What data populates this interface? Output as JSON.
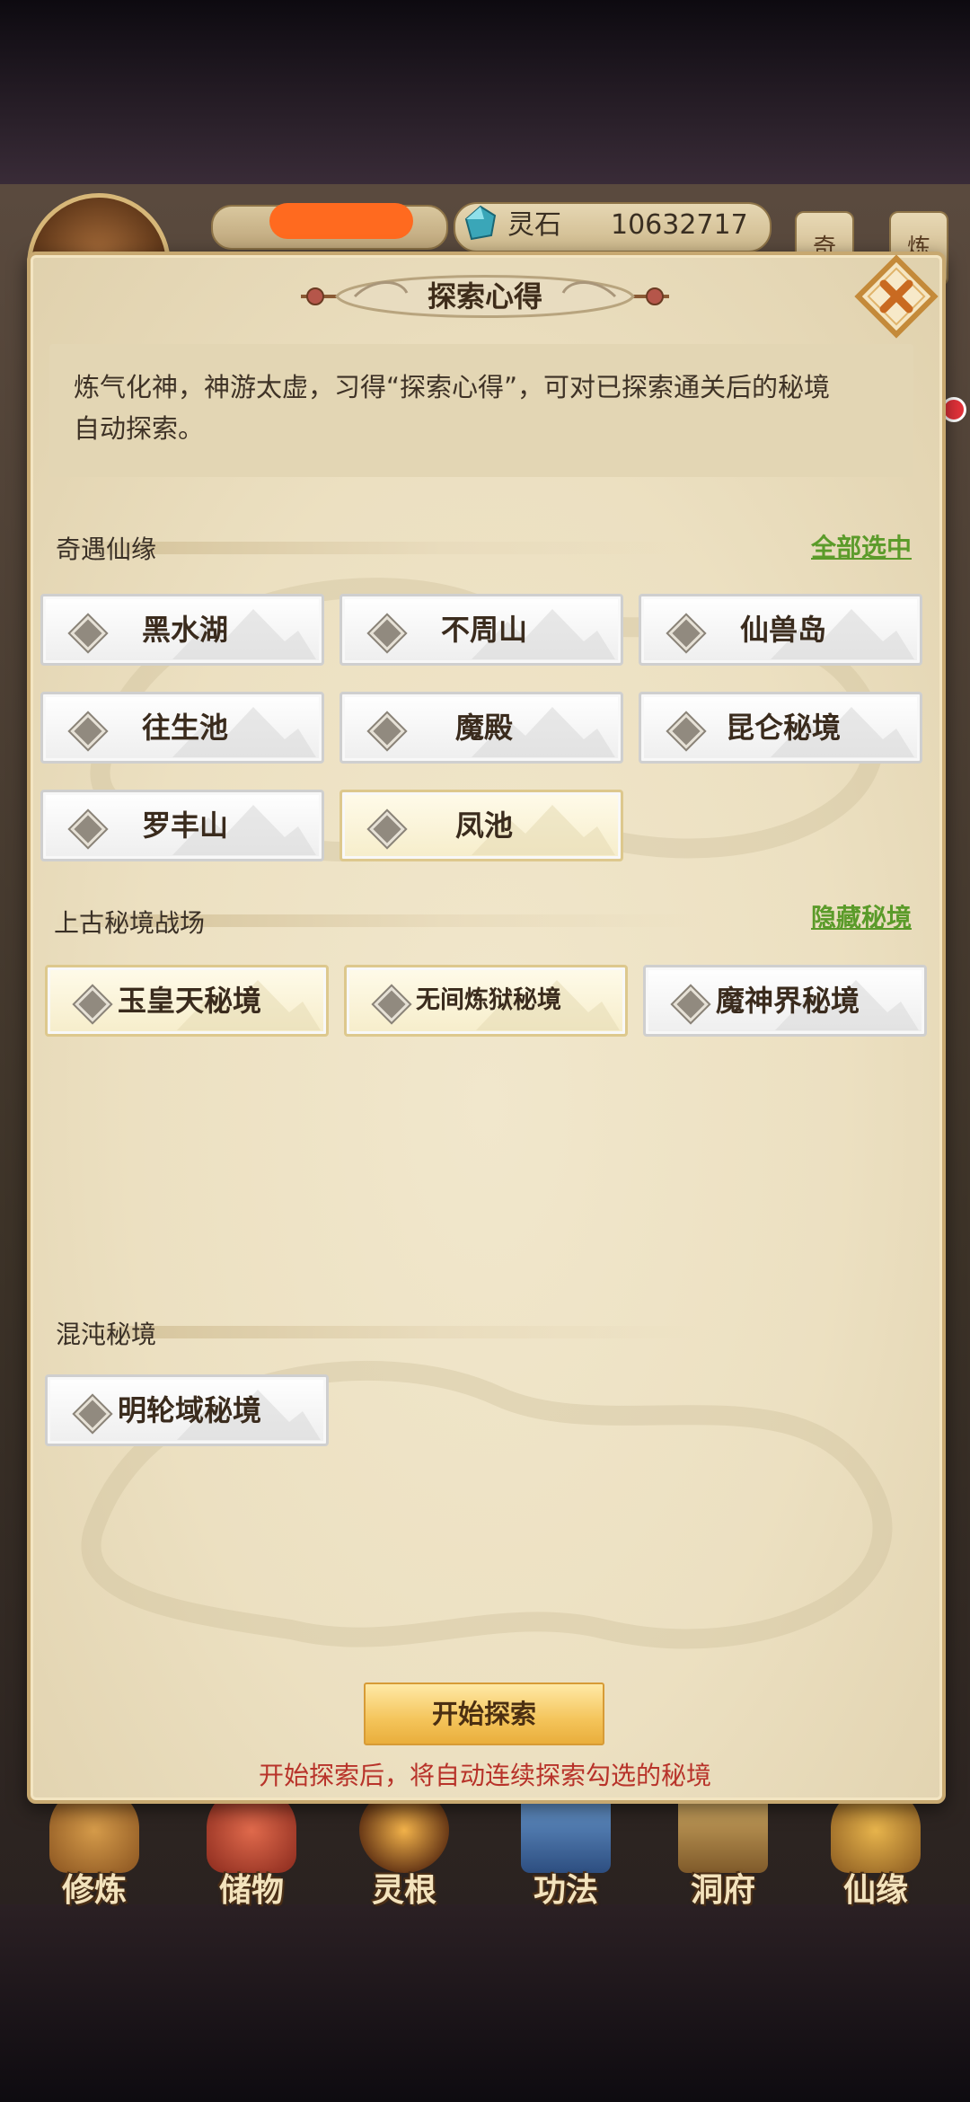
{
  "hud": {
    "currency_label": "灵石",
    "currency_value": "10632717",
    "right_buttons": [
      "奇",
      "炼"
    ]
  },
  "bottom_nav": [
    "修炼",
    "储物",
    "灵根",
    "功法",
    "洞府",
    "仙缘"
  ],
  "modal": {
    "title": "探索心得",
    "description_line1": "炼气化神，神游太虚，习得“探索心得”，可对已探索通关后的秘境",
    "description_line2": "自动探索。",
    "sections": [
      {
        "title": "奇遇仙缘",
        "link": "全部选中",
        "items": [
          {
            "label": "黑水湖",
            "selected": false
          },
          {
            "label": "不周山",
            "selected": false
          },
          {
            "label": "仙兽岛",
            "selected": false
          },
          {
            "label": "往生池",
            "selected": false
          },
          {
            "label": "魔殿",
            "selected": false
          },
          {
            "label": "昆仑秘境",
            "selected": false
          },
          {
            "label": "罗丰山",
            "selected": false
          },
          {
            "label": "凤池",
            "selected": false,
            "style": "gold"
          }
        ]
      },
      {
        "title": "上古秘境战场",
        "link": "隐藏秘境",
        "items": [
          {
            "label": "玉皇天秘境",
            "selected": false,
            "style": "gold"
          },
          {
            "label": "无间炼狱秘境",
            "selected": false,
            "style": "gold"
          },
          {
            "label": "魔神界秘境",
            "selected": false
          }
        ]
      },
      {
        "title": "混沌秘境",
        "items": [
          {
            "label": "明轮域秘境",
            "selected": false
          }
        ]
      }
    ],
    "start_button": "开始探索",
    "hint": "开始探索后，将自动连续探索勾选的秘境"
  },
  "colors": {
    "accent_green": "#5b9b2a",
    "hint_red": "#b8332a",
    "button_gold": "#f4c45a"
  }
}
